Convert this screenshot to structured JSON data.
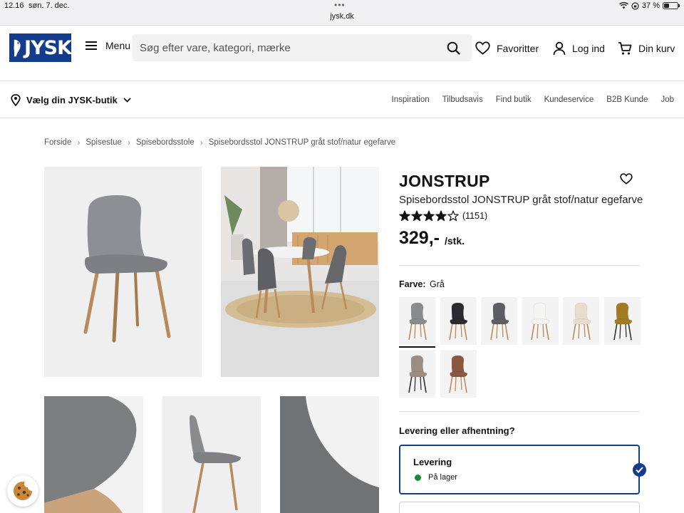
{
  "status_bar": {
    "time": "12.16",
    "date": "søn. 7. dec.",
    "url": "jysk.dk",
    "battery": "37 %",
    "battery_level": 0.37
  },
  "header": {
    "logo": "JYSK",
    "menu_label": "Menu",
    "search_placeholder": "Søg efter vare, kategori, mærke",
    "favorites_label": "Favoritter",
    "login_label": "Log ind",
    "cart_label": "Din kurv",
    "brand_color": "#143c8c"
  },
  "subnav": {
    "store_picker": "Vælg din JYSK-butik",
    "links": [
      "Inspiration",
      "Tilbudsavis",
      "Find butik",
      "Kundeservice",
      "B2B Kunde",
      "Job"
    ]
  },
  "breadcrumb": [
    "Forside",
    "Spisestue",
    "Spisebordsstole",
    "Spisebordsstol JONSTRUP gråt stof/natur egefarve"
  ],
  "product": {
    "title": "JONSTRUP",
    "subtitle": "Spisebordsstol JONSTRUP gråt stof/natur egefarve",
    "rating": 4,
    "rating_max": 5,
    "review_count": "(1151)",
    "price": "329,-",
    "unit": "/stk.",
    "color_label": "Farve:",
    "color_value": "Grå",
    "swatches": [
      {
        "name": "grå",
        "seat": "#8a8b8d",
        "legs": "#b98a5c",
        "selected": true
      },
      {
        "name": "sort",
        "seat": "#2b2b2d",
        "legs": "#b98a5c",
        "selected": false
      },
      {
        "name": "mørkegrå",
        "seat": "#5d5e61",
        "legs": "#b98a5c",
        "selected": false
      },
      {
        "name": "hvid",
        "seat": "#f4f4f2",
        "legs": "#b98a5c",
        "selected": false
      },
      {
        "name": "creme",
        "seat": "#e6ddcd",
        "legs": "#b98a5c",
        "selected": false
      },
      {
        "name": "okker",
        "seat": "#a27b22",
        "legs": "#333333",
        "selected": false
      },
      {
        "name": "taupe",
        "seat": "#9c8d83",
        "legs": "#333333",
        "selected": false
      },
      {
        "name": "brun",
        "seat": "#8c5740",
        "legs": "#b98a5c",
        "selected": false
      }
    ]
  },
  "delivery": {
    "question": "Levering eller afhentning?",
    "option_title": "Levering",
    "stock_status": "På lager",
    "stock_color": "#1a8a3a"
  }
}
